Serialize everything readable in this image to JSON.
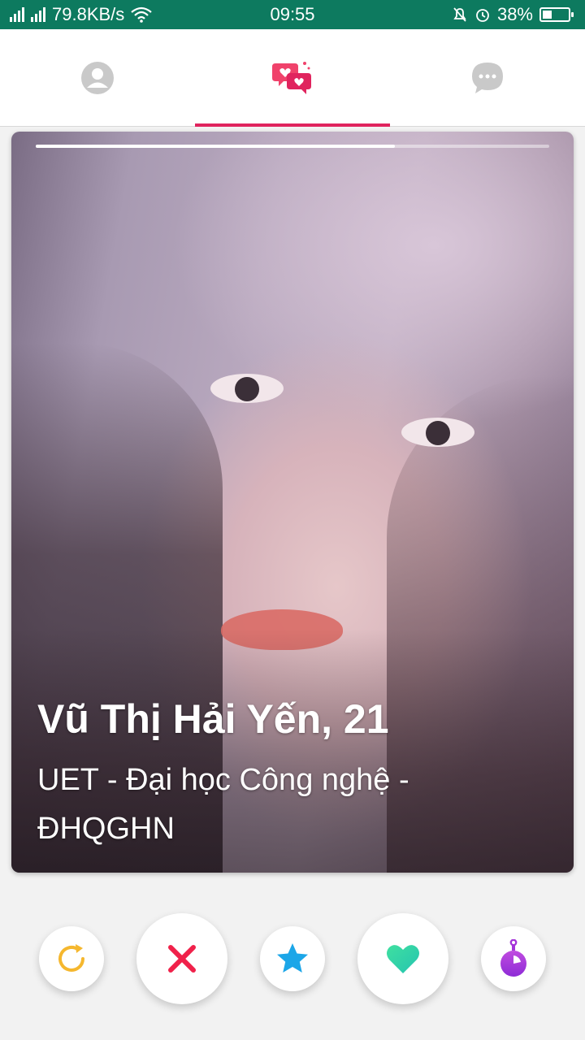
{
  "status_bar": {
    "network_speed": "79.8KB/s",
    "time": "09:55",
    "battery_percent": "38%",
    "battery_level": 0.38,
    "icons": [
      "signal-icon",
      "signal-icon",
      "wifi-icon",
      "bell-muted-icon",
      "alarm-icon",
      "battery-icon"
    ]
  },
  "top_nav": {
    "tabs": [
      {
        "icon": "profile-icon",
        "active": false
      },
      {
        "icon": "matches-hearts-icon",
        "active": true
      },
      {
        "icon": "chat-icon",
        "active": false
      }
    ],
    "colors": {
      "active": "#e0245e",
      "inactive": "#c4c4c4"
    }
  },
  "card": {
    "name_age": "Vũ Thị Hải Yến, 21",
    "school": "UET - Đại học Công nghệ - ĐHQGHN",
    "photo_progress": 0.7
  },
  "actions": [
    {
      "name": "rewind-button",
      "icon": "rewind-icon",
      "color": "#f5b72e"
    },
    {
      "name": "nope-button",
      "icon": "close-icon",
      "color": "#f0214a"
    },
    {
      "name": "super-like-button",
      "icon": "star-icon",
      "color": "#1ca6e8"
    },
    {
      "name": "like-button",
      "icon": "heart-icon",
      "color": "#34d99a"
    },
    {
      "name": "boost-button",
      "icon": "boost-icon",
      "color": "#a434d9"
    }
  ],
  "colors": {
    "status_bar": "#0d7a5f",
    "accent": "#e0245e"
  }
}
